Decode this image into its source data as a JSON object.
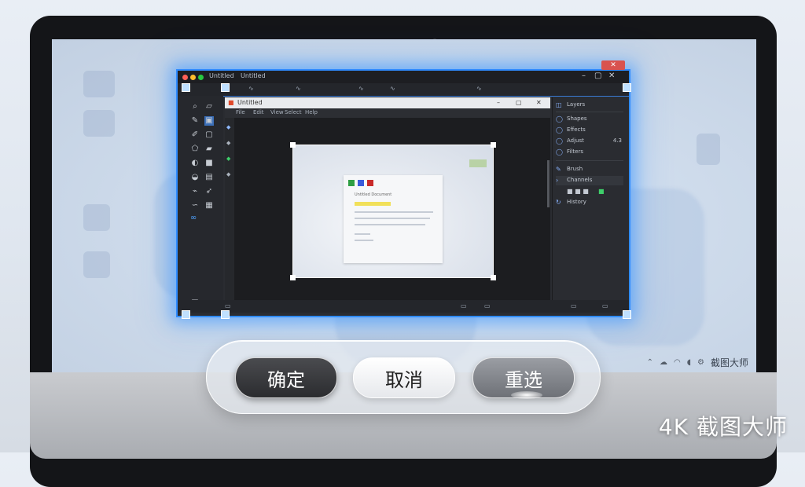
{
  "taskbar": {
    "tray_icons": [
      "chevron-up-icon",
      "cloud-icon",
      "wifi-icon",
      "volume-icon",
      "settings-icon"
    ],
    "app_label": "截图大师"
  },
  "captured_window": {
    "title_tabs": [
      "Untitled",
      "Untitled"
    ],
    "doc_title": "Untitled",
    "doc_toolbar": [
      "File",
      "Edit",
      "View",
      "Select",
      "Help"
    ],
    "inner_card_lines": [
      "Untitled Document"
    ],
    "right_panel": [
      {
        "icon": "layers-icon",
        "label": "Layers"
      },
      {
        "icon": "circle-icon",
        "label": "Shapes"
      },
      {
        "icon": "circle-icon",
        "label": "Effects"
      },
      {
        "icon": "circle-icon",
        "label": "Adjust",
        "value": "4.3"
      },
      {
        "icon": "circle-icon",
        "label": "Filters"
      },
      {
        "icon": "pencil-icon",
        "label": "Brush"
      },
      {
        "icon": "chevron-right-icon",
        "label": "Channels"
      },
      {
        "icon": "history-icon",
        "label": "History"
      }
    ]
  },
  "actions": {
    "confirm_label": "确定",
    "cancel_label": "取消",
    "reselect_label": "重选"
  },
  "brand": {
    "text": "4K 截图大师"
  },
  "colors": {
    "selection_accent": "#2f8bff",
    "confirm_bg": "#2b2c2f",
    "cancel_bg": "#ffffff",
    "reselect_bg": "#7a7d83"
  }
}
